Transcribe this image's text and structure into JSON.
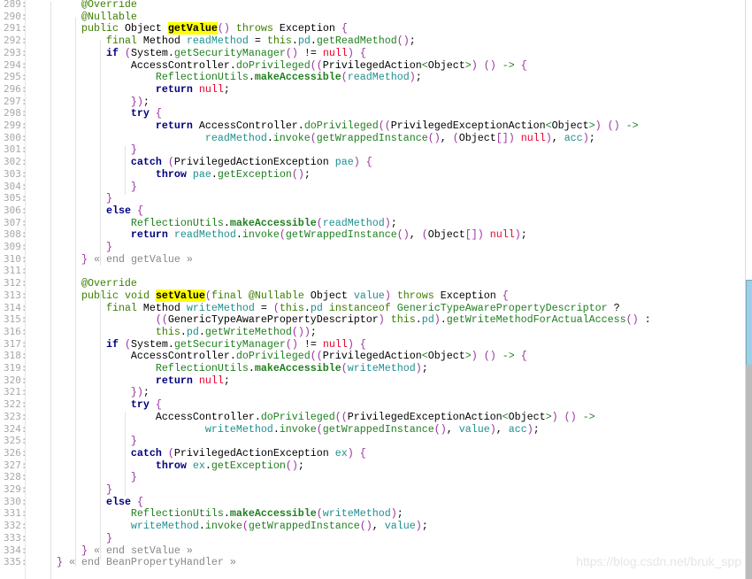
{
  "editor": {
    "first_line": 289,
    "highlight_words": [
      "getValue",
      "setValue"
    ],
    "lines": [
      "        @Override",
      "        @Nullable",
      "        public Object getValue() throws Exception {",
      "            final Method readMethod = this.pd.getReadMethod();",
      "            if (System.getSecurityManager() != null) {",
      "                AccessController.doPrivileged((PrivilegedAction<Object>) () -> {",
      "                    ReflectionUtils.makeAccessible(readMethod);",
      "                    return null;",
      "                });",
      "                try {",
      "                    return AccessController.doPrivileged((PrivilegedExceptionAction<Object>) () ->",
      "                            readMethod.invoke(getWrappedInstance(), (Object[]) null), acc);",
      "                }",
      "                catch (PrivilegedActionException pae) {",
      "                    throw pae.getException();",
      "                }",
      "            }",
      "            else {",
      "                ReflectionUtils.makeAccessible(readMethod);",
      "                return readMethod.invoke(getWrappedInstance(), (Object[]) null);",
      "            }",
      "        } « end getValue »",
      "",
      "        @Override",
      "        public void setValue(final @Nullable Object value) throws Exception {",
      "            final Method writeMethod = (this.pd instanceof GenericTypeAwarePropertyDescriptor ?",
      "                    ((GenericTypeAwarePropertyDescriptor) this.pd).getWriteMethodForActualAccess() :",
      "                    this.pd.getWriteMethod());",
      "            if (System.getSecurityManager() != null) {",
      "                AccessController.doPrivileged((PrivilegedAction<Object>) () -> {",
      "                    ReflectionUtils.makeAccessible(writeMethod);",
      "                    return null;",
      "                });",
      "                try {",
      "                    AccessController.doPrivileged((PrivilegedExceptionAction<Object>) () ->",
      "                            writeMethod.invoke(getWrappedInstance(), value), acc);",
      "                }",
      "                catch (PrivilegedActionException ex) {",
      "                    throw ex.getException();",
      "                }",
      "            }",
      "            else {",
      "                ReflectionUtils.makeAccessible(writeMethod);",
      "                writeMethod.invoke(getWrappedInstance(), value);",
      "            }",
      "        } « end setValue »",
      "    } « end BeanPropertyHandler »"
    ]
  },
  "watermark": "https://blog.csdn.net/bruk_spp",
  "colors": {
    "keyword": "#00007f",
    "modifier": "#3c7f00",
    "null": "#e8002a",
    "highlight": "#ffff00",
    "minimap_view": "#9ccfe8"
  }
}
